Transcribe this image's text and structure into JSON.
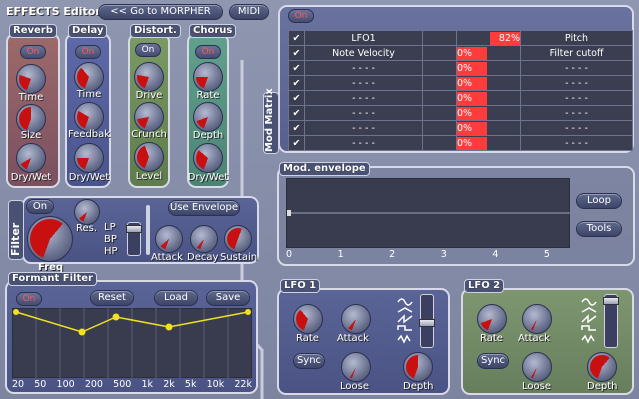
{
  "header": {
    "title": "EFFECTS Editor",
    "morpher_button": "<< Go to MORPHER",
    "midi_button": "MIDI"
  },
  "reverb": {
    "label": "Reverb",
    "on": "On",
    "knobs": [
      "Time",
      "Size",
      "Dry/Wet"
    ]
  },
  "delay": {
    "label": "Delay",
    "on": "On",
    "knobs": [
      "Time",
      "Feedbak",
      "Dry/Wet"
    ]
  },
  "distort": {
    "label": "Distort.",
    "on": "On",
    "knobs": [
      "Drive",
      "Crunch",
      "Level"
    ]
  },
  "chorus": {
    "label": "Chorus",
    "on": "On",
    "knobs": [
      "Rate",
      "Depth",
      "Dry/Wet"
    ]
  },
  "filter": {
    "label": "Filter",
    "on": "On",
    "res": "Res.",
    "freq": "Freq",
    "modes": [
      "LP",
      "BP",
      "HP"
    ],
    "use_envelope": "Use Envelope",
    "knobs": [
      "Attack",
      "Decay",
      "Sustain"
    ]
  },
  "formant": {
    "label": "Formant Filter",
    "on": "On",
    "reset": "Reset",
    "load": "Load",
    "save": "Save",
    "freq_labels": [
      "20",
      "50",
      "100",
      "200",
      "500",
      "1k",
      "2k",
      "5k",
      "10k",
      "22k"
    ]
  },
  "mod_matrix": {
    "label": "Mod Matrix",
    "on": "On",
    "rows": [
      {
        "source": "LFO1",
        "amount": "82%",
        "dest": "Pitch"
      },
      {
        "source": "Note Velocity",
        "amount": "0%",
        "dest": "Filter cutoff"
      },
      {
        "source": "- - - -",
        "amount": "0%",
        "dest": "- - - -"
      },
      {
        "source": "- - - -",
        "amount": "0%",
        "dest": "- - - -"
      },
      {
        "source": "- - - -",
        "amount": "0%",
        "dest": "- - - -"
      },
      {
        "source": "- - - -",
        "amount": "0%",
        "dest": "- - - -"
      },
      {
        "source": "- - - -",
        "amount": "0%",
        "dest": "- - - -"
      },
      {
        "source": "- - - -",
        "amount": "0%",
        "dest": "- - - -"
      }
    ]
  },
  "mod_envelope": {
    "label": "Mod. envelope",
    "loop": "Loop",
    "tools": "Tools",
    "axis": [
      "0",
      "1",
      "2",
      "3",
      "4",
      "5"
    ]
  },
  "lfo1": {
    "label": "LFO 1",
    "rate": "Rate",
    "attack": "Attack",
    "sync": "Sync",
    "loose": "Loose",
    "depth": "Depth"
  },
  "lfo2": {
    "label": "LFO 2",
    "rate": "Rate",
    "attack": "Attack",
    "sync": "Sync",
    "loose": "Loose",
    "depth": "Depth"
  },
  "colors": {
    "accent": "#ff3b3b",
    "check": "#4dff4d",
    "panel": "#3a3e50"
  }
}
